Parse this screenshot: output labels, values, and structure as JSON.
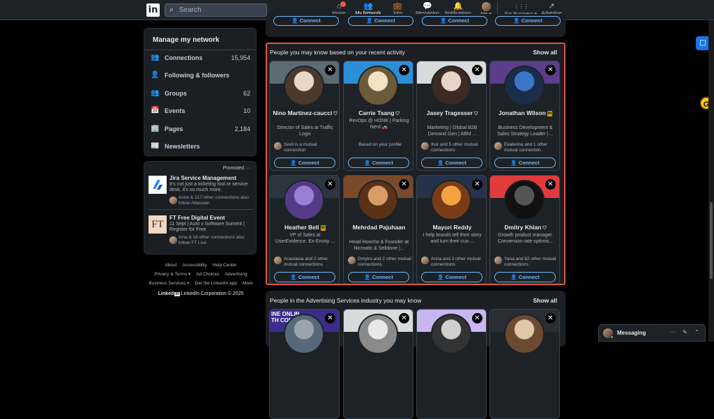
{
  "nav": {
    "logo": "in",
    "search_placeholder": "Search",
    "items": [
      {
        "label": "Home",
        "icon": "⌂"
      },
      {
        "label": "My Network",
        "icon": "👥"
      },
      {
        "label": "Jobs",
        "icon": "💼"
      },
      {
        "label": "Messaging",
        "icon": "💬"
      },
      {
        "label": "Notifications",
        "icon": "🔔"
      },
      {
        "label": "Me ▾",
        "icon": ""
      },
      {
        "label": "For Business ▾",
        "icon": "⋮⋮⋮"
      },
      {
        "label": "Advertise",
        "icon": "↗"
      }
    ]
  },
  "manage": {
    "title": "Manage my network",
    "rows": [
      {
        "label": "Connections",
        "count": "15,954",
        "icon": "👥"
      },
      {
        "label": "Following & followers",
        "count": "",
        "icon": "👤"
      },
      {
        "label": "Groups",
        "count": "62",
        "icon": "👥"
      },
      {
        "label": "Events",
        "count": "10",
        "icon": "📅"
      },
      {
        "label": "Pages",
        "count": "2,184",
        "icon": "🏢"
      },
      {
        "label": "Newsletters",
        "count": "",
        "icon": "📰"
      }
    ]
  },
  "promoted": {
    "label": "Promoted ···",
    "items": [
      {
        "title": "Jira Service Management",
        "text": "It's not just a ticketing tool or service desk, it's so much more.",
        "meta": "Anne & 317 other connections also follow Atlassian"
      },
      {
        "title": "FT Free Digital Event",
        "text": "11 Sept | Auto x Software Summit | Register for Free",
        "meta": "Inna & 16 other connections also follow FT Live",
        "logo_text": "FT"
      }
    ]
  },
  "footer": {
    "line1": [
      "About",
      "Accessibility",
      "Help Center"
    ],
    "line2": [
      "Privacy & Terms ▾",
      "Ad Choices",
      "Advertising"
    ],
    "line3": [
      "Business Services ▾",
      "Get the LinkedIn app",
      "More"
    ],
    "brand_text": "Linked",
    "brand_in": "in",
    "copyright": "LinkedIn Corporation © 2025"
  },
  "top_connect_label": "Connect",
  "section1": {
    "title": "People you may know based on your recent activity",
    "show_all": "Show all",
    "people": [
      {
        "name": "Nino Martinez-caucci",
        "badge": "verified",
        "headline": "Director of Sales at Traffic Logix",
        "mutual": "Sevil is a mutual connection",
        "button": "Connect",
        "banner": "#5d6b75",
        "avatar": [
          "#e8d8c8",
          "#4a3a2e"
        ]
      },
      {
        "name": "Carrie Tsang",
        "badge": "verified",
        "headline": "RevOps @ HONK | Parking Nerd 🚗",
        "mutual": "Based on your profile",
        "button": "Connect",
        "banner": "#2b8fd6",
        "avatar": [
          "#f2e3c6",
          "#6b5b3a"
        ]
      },
      {
        "name": "Jasey Tragesser",
        "badge": "verified",
        "headline": "Marketing | Global B2B Demand Gen | ABM ...",
        "mutual": "Ihor and 5 other mutual connections",
        "button": "Connect",
        "banner": "#d8dadc",
        "avatar": [
          "#e6d5c6",
          "#3a2a22"
        ]
      },
      {
        "name": "Jonathan Wilson",
        "badge": "in",
        "headline": "Business Development & Sales Strategy Leader | ...",
        "mutual": "Ekaterina and 1 other mutual connection",
        "button": "Connect",
        "banner": "#5b3d8c",
        "avatar": [
          "#3a77c7",
          "#1a2d4a"
        ]
      },
      {
        "name": "Heather Bell",
        "badge": "in",
        "headline": "VP of Sales at UserEvidence. Ex-Envoy ...",
        "mutual": "Anastasia and 2 other mutual connections",
        "button": "Connect",
        "banner": "#2c3440",
        "avatar": [
          "#9b7fd4",
          "#553a8a"
        ]
      },
      {
        "name": "Mehrdad Pajuhaan",
        "badge": "",
        "headline": "Head Honcho & Founder at Nicmatic & Selldone |...",
        "mutual": "Dmytro and 2 other mutual connections",
        "button": "Connect",
        "banner": "#7a4a2a",
        "avatar": [
          "#d89c66",
          "#5a3218"
        ]
      },
      {
        "name": "Mayuri Reddy",
        "badge": "",
        "headline": "I help brands tell their story and turn their cus-...",
        "mutual": "Anna and 3 other mutual connections",
        "button": "Connect",
        "banner": "#24324a",
        "avatar": [
          "#f4a342",
          "#7a3c16"
        ]
      },
      {
        "name": "Dmitry Khlan",
        "badge": "verified",
        "headline": "Growth product manager. Conversion rate optimis...",
        "mutual": "Yana and 82 other mutual connections",
        "button": "Connect",
        "banner": "#e23b3b",
        "avatar": [
          "#555",
          "#111"
        ]
      }
    ]
  },
  "section2": {
    "title": "People in the Advertising Services industry you may know",
    "show_all": "Show all",
    "banner_text": [
      "INE ONLIN",
      "TH CON"
    ],
    "banner_colors": [
      "#3b2c8a",
      "#d8dadc",
      "#c9b6f0",
      "#2a2d33"
    ],
    "avatar_colors": [
      [
        "#9aa3ab",
        "#56687a"
      ],
      [
        "#e8e8e8",
        "#8a8a8a"
      ],
      [
        "#cfcfcf",
        "#333"
      ],
      [
        "#e0c7a8",
        "#6a4a30"
      ]
    ]
  },
  "messaging": {
    "label": "Messaging",
    "icons": [
      "···",
      "✎",
      "⌃"
    ]
  }
}
